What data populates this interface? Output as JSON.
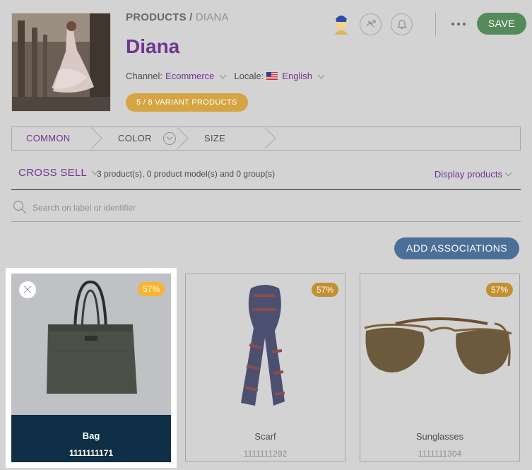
{
  "product": {
    "breadcrumb_root": "PRODUCTS",
    "breadcrumb_separator": " / ",
    "breadcrumb_current": "DIANA",
    "title": "Diana",
    "channel_label": "Channel:",
    "channel_value": "Ecommerce",
    "locale_label": "Locale:",
    "locale_value": "English",
    "variant_badge": "5 / 8 VARIANT PRODUCTS"
  },
  "actions": {
    "save_label": "SAVE"
  },
  "tabs": [
    {
      "label": "COMMON",
      "active": true
    },
    {
      "label": "COLOR",
      "active": false
    },
    {
      "label": "SIZE",
      "active": false
    }
  ],
  "associations": {
    "type_label": "CROSS SELL",
    "count_text": "3 product(s), 0 product model(s) and 0 group(s)",
    "display_label": "Display products",
    "search_placeholder": "Search on label or identifier",
    "add_label": "ADD ASSOCIATIONS",
    "products": [
      {
        "name": "Bag",
        "identifier": "1111111171",
        "completeness": "57%"
      },
      {
        "name": "Scarf",
        "identifier": "1111111292",
        "completeness": "57%"
      },
      {
        "name": "Sunglasses",
        "identifier": "1111111304",
        "completeness": "57%"
      }
    ]
  },
  "colors": {
    "accent_purple": "#70348f",
    "save_green": "#558a5a",
    "add_blue": "#4b6f97",
    "badge_yellow": "#d4a541",
    "card_footer_dark": "#0e2f45"
  }
}
